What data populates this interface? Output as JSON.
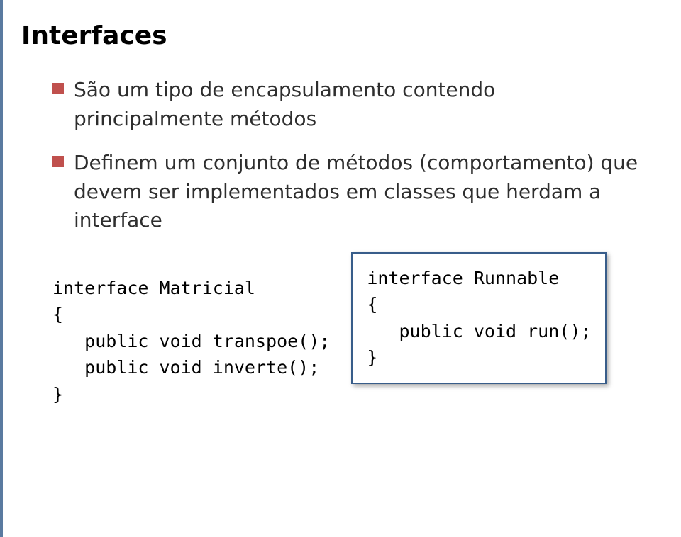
{
  "title": "Interfaces",
  "bullets": [
    "São um tipo de encapsulamento contendo principalmente métodos",
    "Definem um conjunto de métodos (comportamento) que devem ser implementados em classes que herdam a interface"
  ],
  "codeA": "interface Matricial\n{\n   public void transpoe();\n   public void inverte();\n}",
  "codeB": "interface Runnable\n{\n   public void run();\n}"
}
